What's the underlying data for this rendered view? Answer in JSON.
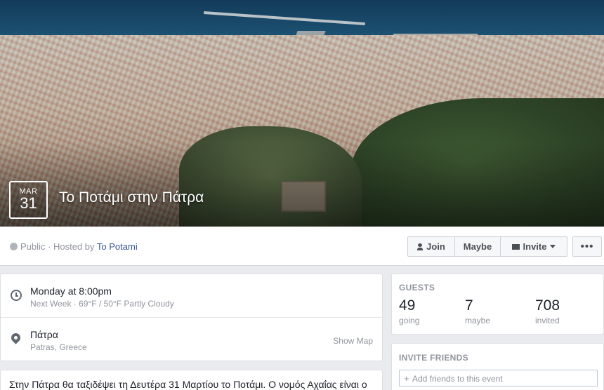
{
  "event": {
    "month": "MAR",
    "day": "31",
    "title": "Το Ποτάμι στην Πάτρα",
    "privacy": "Public",
    "hosted_by_label": "· Hosted by",
    "host": "To Potami"
  },
  "actions": {
    "join": "Join",
    "maybe": "Maybe",
    "invite": "Invite",
    "more": "•••"
  },
  "details": {
    "time": "Monday at 8:00pm",
    "weather": "Next Week · 69°F / 50°F Partly Cloudy",
    "location": "Πάτρα",
    "location_sub": "Patras, Greece",
    "show_map": "Show Map"
  },
  "description": "Στην Πάτρα θα ταξιδέψει τη Δευτέρα 31 Μαρτίου το Ποτάμι. Ο νομός Αχαΐας είναι ο",
  "guests": {
    "title": "GUESTS",
    "stats": [
      {
        "count": "49",
        "label": "going"
      },
      {
        "count": "7",
        "label": "maybe"
      },
      {
        "count": "708",
        "label": "invited"
      }
    ]
  },
  "invite_friends": {
    "title": "INVITE FRIENDS",
    "placeholder": "Add friends to this event"
  },
  "icons": [
    "globe-icon",
    "person-icon",
    "mail-icon",
    "chevron-down-icon",
    "clock-icon",
    "map-pin-icon",
    "plus-icon"
  ]
}
